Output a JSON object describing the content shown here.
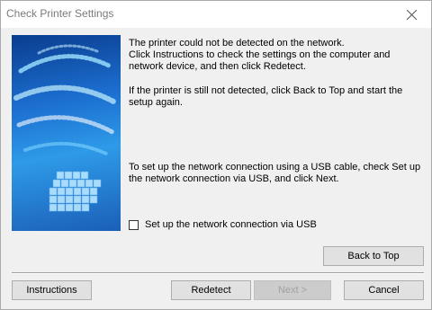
{
  "window": {
    "title": "Check Printer Settings"
  },
  "message": {
    "line1": "The printer could not be detected on the network.",
    "line2": "Click Instructions to check the settings on the computer and network device, and then click Redetect.",
    "line3": "If the printer is still not detected, click Back to Top and start the setup again.",
    "line4": "To set up the network connection using a USB cable, check Set up the network connection via USB, and click Next."
  },
  "usb_option": {
    "label": "Set up the network connection via USB",
    "checked": false
  },
  "buttons": {
    "back_to_top": "Back to Top",
    "instructions": "Instructions",
    "redetect": "Redetect",
    "next": "Next >",
    "cancel": "Cancel"
  },
  "colors": {
    "banner_dark": "#0a3d8f",
    "banner_light": "#2e9ae8",
    "title_text": "#7a7a7a"
  },
  "icons": {
    "close": "close-icon",
    "banner": "printer-setup-banner"
  }
}
